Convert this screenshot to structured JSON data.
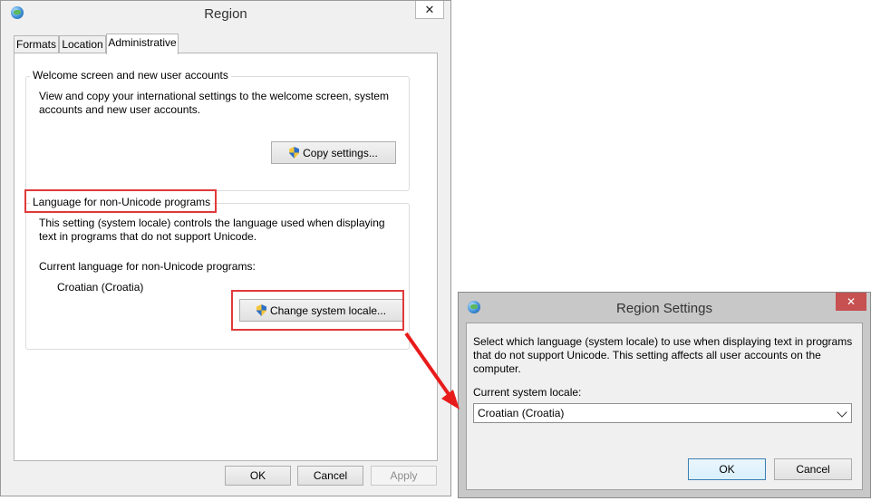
{
  "region_window": {
    "title": "Region",
    "close_glyph": "✕",
    "tabs": [
      {
        "label": "Formats"
      },
      {
        "label": "Location"
      },
      {
        "label": "Administrative"
      }
    ],
    "welcome_group": {
      "legend": "Welcome screen and new user accounts",
      "description": "View and copy your international settings to the welcome screen, system accounts and new user accounts.",
      "button_label": "Copy settings..."
    },
    "non_unicode_group": {
      "legend": "Language for non-Unicode programs",
      "description": "This setting (system locale) controls the language used when displaying text in programs that do not support Unicode.",
      "current_label": "Current language for non-Unicode programs:",
      "current_value": "Croatian (Croatia)",
      "button_label": "Change system locale..."
    },
    "footer": {
      "ok": "OK",
      "cancel": "Cancel",
      "apply": "Apply"
    }
  },
  "region_settings_dialog": {
    "title": "Region Settings",
    "close_glyph": "✕",
    "description": "Select which language (system locale) to use when displaying text in programs that do not support Unicode. This setting affects all user accounts on the computer.",
    "locale_label": "Current system locale:",
    "locale_value": "Croatian (Croatia)",
    "ok": "OK",
    "cancel": "Cancel"
  },
  "colors": {
    "highlight": "#e03a3a",
    "close_red": "#c75050",
    "window_bg": "#f0f0f0"
  },
  "icons": [
    "globe-icon",
    "close-icon",
    "uac-shield-icon",
    "chevron-down-icon",
    "arrow-annotation"
  ]
}
